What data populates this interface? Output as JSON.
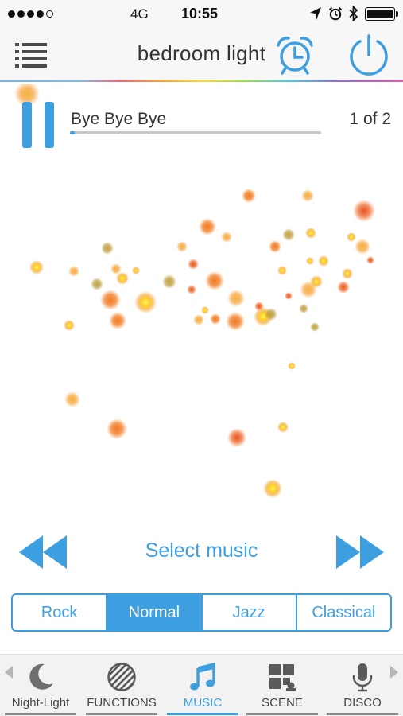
{
  "status_bar": {
    "network": "4G",
    "time": "10:55",
    "icons": [
      "location-arrow-icon",
      "alarm-clock-icon",
      "bluetooth-icon",
      "battery-icon"
    ]
  },
  "header": {
    "title": "bedroom light",
    "icons": [
      "menu-list-icon",
      "alarm-clock-icon",
      "power-icon"
    ]
  },
  "player": {
    "song_title": "Bye Bye Bye",
    "track_count": "1 of 2",
    "progress": 0.02,
    "state": "playing"
  },
  "controls": {
    "select_music_label": "Select music",
    "rewind_icon": "rewind-icon",
    "forward_icon": "fast-forward-icon"
  },
  "genres": [
    {
      "label": "Rock",
      "active": false
    },
    {
      "label": "Normal",
      "active": true
    },
    {
      "label": "Jazz",
      "active": false
    },
    {
      "label": "Classical",
      "active": false
    }
  ],
  "tabs": [
    {
      "label": "Night-Light",
      "icon": "moon-icon",
      "active": false
    },
    {
      "label": "FUNCTIONS",
      "icon": "striped-circle-icon",
      "active": false
    },
    {
      "label": "MUSIC",
      "icon": "music-note-icon",
      "active": true
    },
    {
      "label": "SCENE",
      "icon": "scene-grid-icon",
      "active": false
    },
    {
      "label": "DISCO",
      "icon": "microphone-icon",
      "active": false
    }
  ],
  "colors": {
    "accent": "#3d9fe0",
    "particle_core": "#ffd21f",
    "particle_orange": "#f27a21",
    "particle_red": "#e8501f"
  }
}
